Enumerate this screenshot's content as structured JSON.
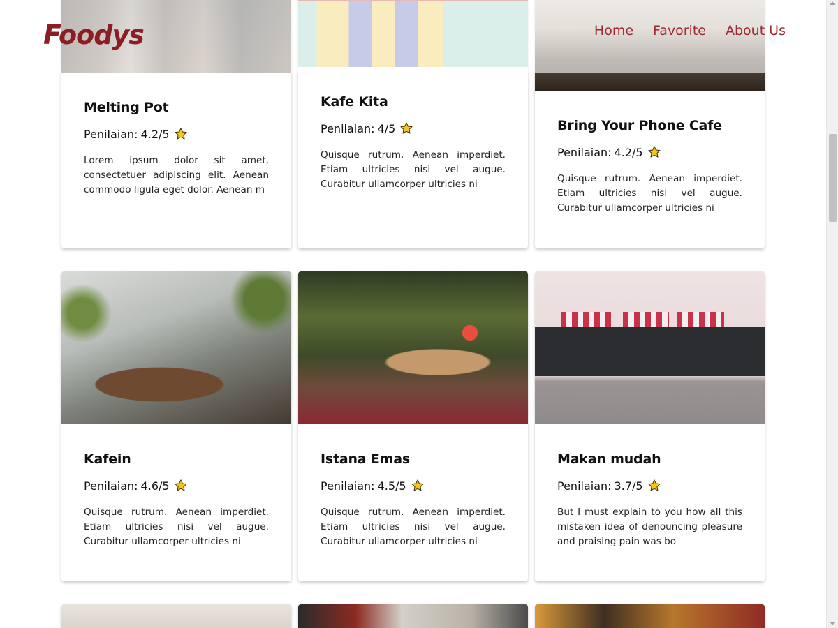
{
  "header": {
    "brand": "Foodys",
    "nav": [
      "Home",
      "Favorite",
      "About Us"
    ]
  },
  "rating_label": "Penilaian:",
  "restaurants": [
    {
      "name": "Melting Pot",
      "rating": "4.2/5",
      "description": "Lorem ipsum dolor sit amet, consectetuer adipiscing elit. Aenean commodo ligula eget dolor. Aenean m"
    },
    {
      "name": "Kafe Kita",
      "rating": "4/5",
      "description": "Quisque rutrum. Aenean imperdiet. Etiam ultricies nisi vel augue. Curabitur ullamcorper ultricies ni"
    },
    {
      "name": "Bring Your Phone Cafe",
      "rating": "4.2/5",
      "description": "Quisque rutrum. Aenean imperdiet. Etiam ultricies nisi vel augue. Curabitur ullamcorper ultricies ni"
    },
    {
      "name": "Kafein",
      "rating": "4.6/5",
      "description": "Quisque rutrum. Aenean imperdiet. Etiam ultricies nisi vel augue. Curabitur ullamcorper ultricies ni"
    },
    {
      "name": "Istana Emas",
      "rating": "4.5/5",
      "description": "Quisque rutrum. Aenean imperdiet. Etiam ultricies nisi vel augue. Curabitur ullamcorper ultricies ni"
    },
    {
      "name": "Makan mudah",
      "rating": "3.7/5",
      "description": "But I must explain to you how all this mistaken idea of denouncing pleasure and praising pain was bo"
    }
  ],
  "colors": {
    "brand": "#8b1d25",
    "nav": "#a0282f",
    "star": "#f5c518",
    "divider": "#b5655c"
  },
  "icons": {
    "rating": "star-icon"
  }
}
